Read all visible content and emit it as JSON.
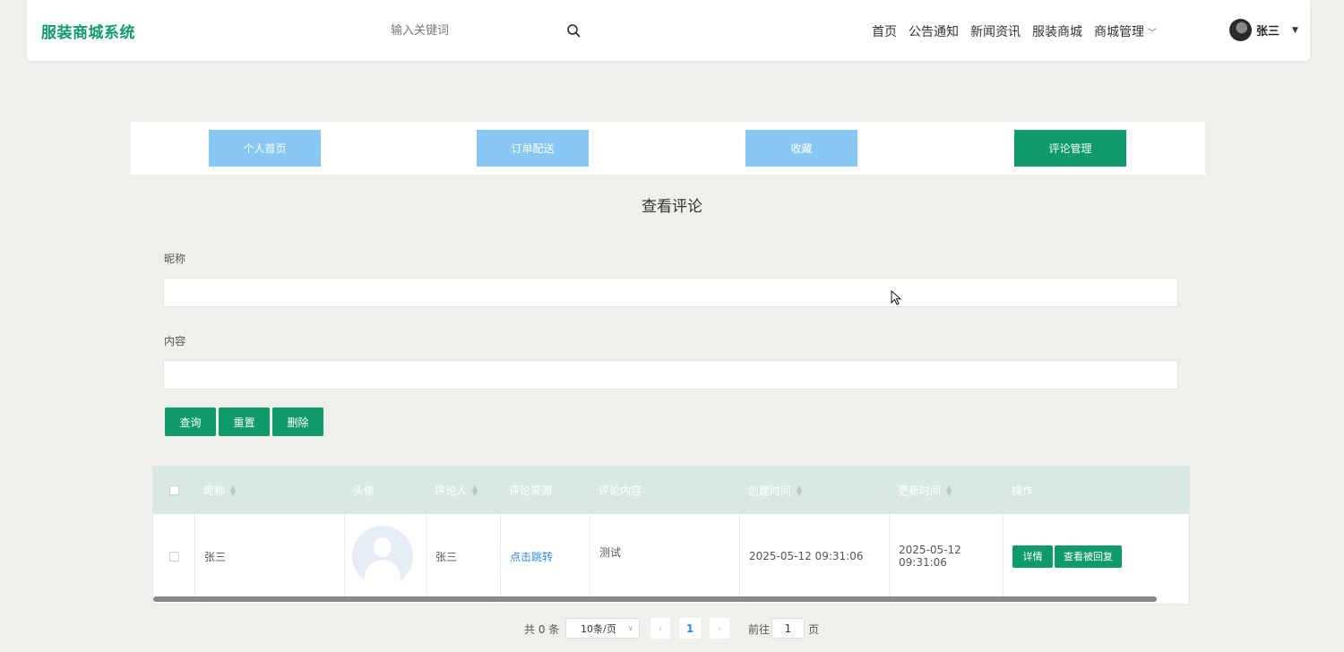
{
  "header": {
    "logo": "服装商城系统",
    "search_placeholder": "输入关键词",
    "nav": [
      "首页",
      "公告通知",
      "新闻资讯",
      "服装商城",
      "商城管理"
    ],
    "user_name": "张三"
  },
  "tabs": [
    {
      "label": "个人首页",
      "active": false
    },
    {
      "label": "订单配送",
      "active": false
    },
    {
      "label": "收藏",
      "active": false
    },
    {
      "label": "评论管理",
      "active": true
    }
  ],
  "page_title": "查看评论",
  "form": {
    "nickname_label": "昵称",
    "nickname_value": "",
    "content_label": "内容",
    "content_value": ""
  },
  "buttons": {
    "query": "查询",
    "reset": "重置",
    "delete": "删除"
  },
  "table": {
    "columns": [
      "昵称",
      "头像",
      "评论人",
      "评论来源",
      "评论内容",
      "创建时间",
      "更新时间",
      "操作"
    ],
    "rows": [
      {
        "nickname": "张三",
        "commenter": "张三",
        "source": "点击跳转",
        "content": "测试",
        "created": "2025-05-12 09:31:06",
        "updated": "2025-05-12 09:31:06",
        "actions": [
          "详情",
          "查看被回复"
        ]
      }
    ]
  },
  "pagination": {
    "total": "共 0 条",
    "page_size": "10条/页",
    "current_page": "1",
    "goto_label": "前往",
    "goto_value": "1",
    "page_suffix": "页"
  },
  "colors": {
    "brand": "#0f9a6a",
    "tab_inactive": "#87c8f5",
    "table_header": "#d7e9e2",
    "link": "#2d8ce8"
  }
}
